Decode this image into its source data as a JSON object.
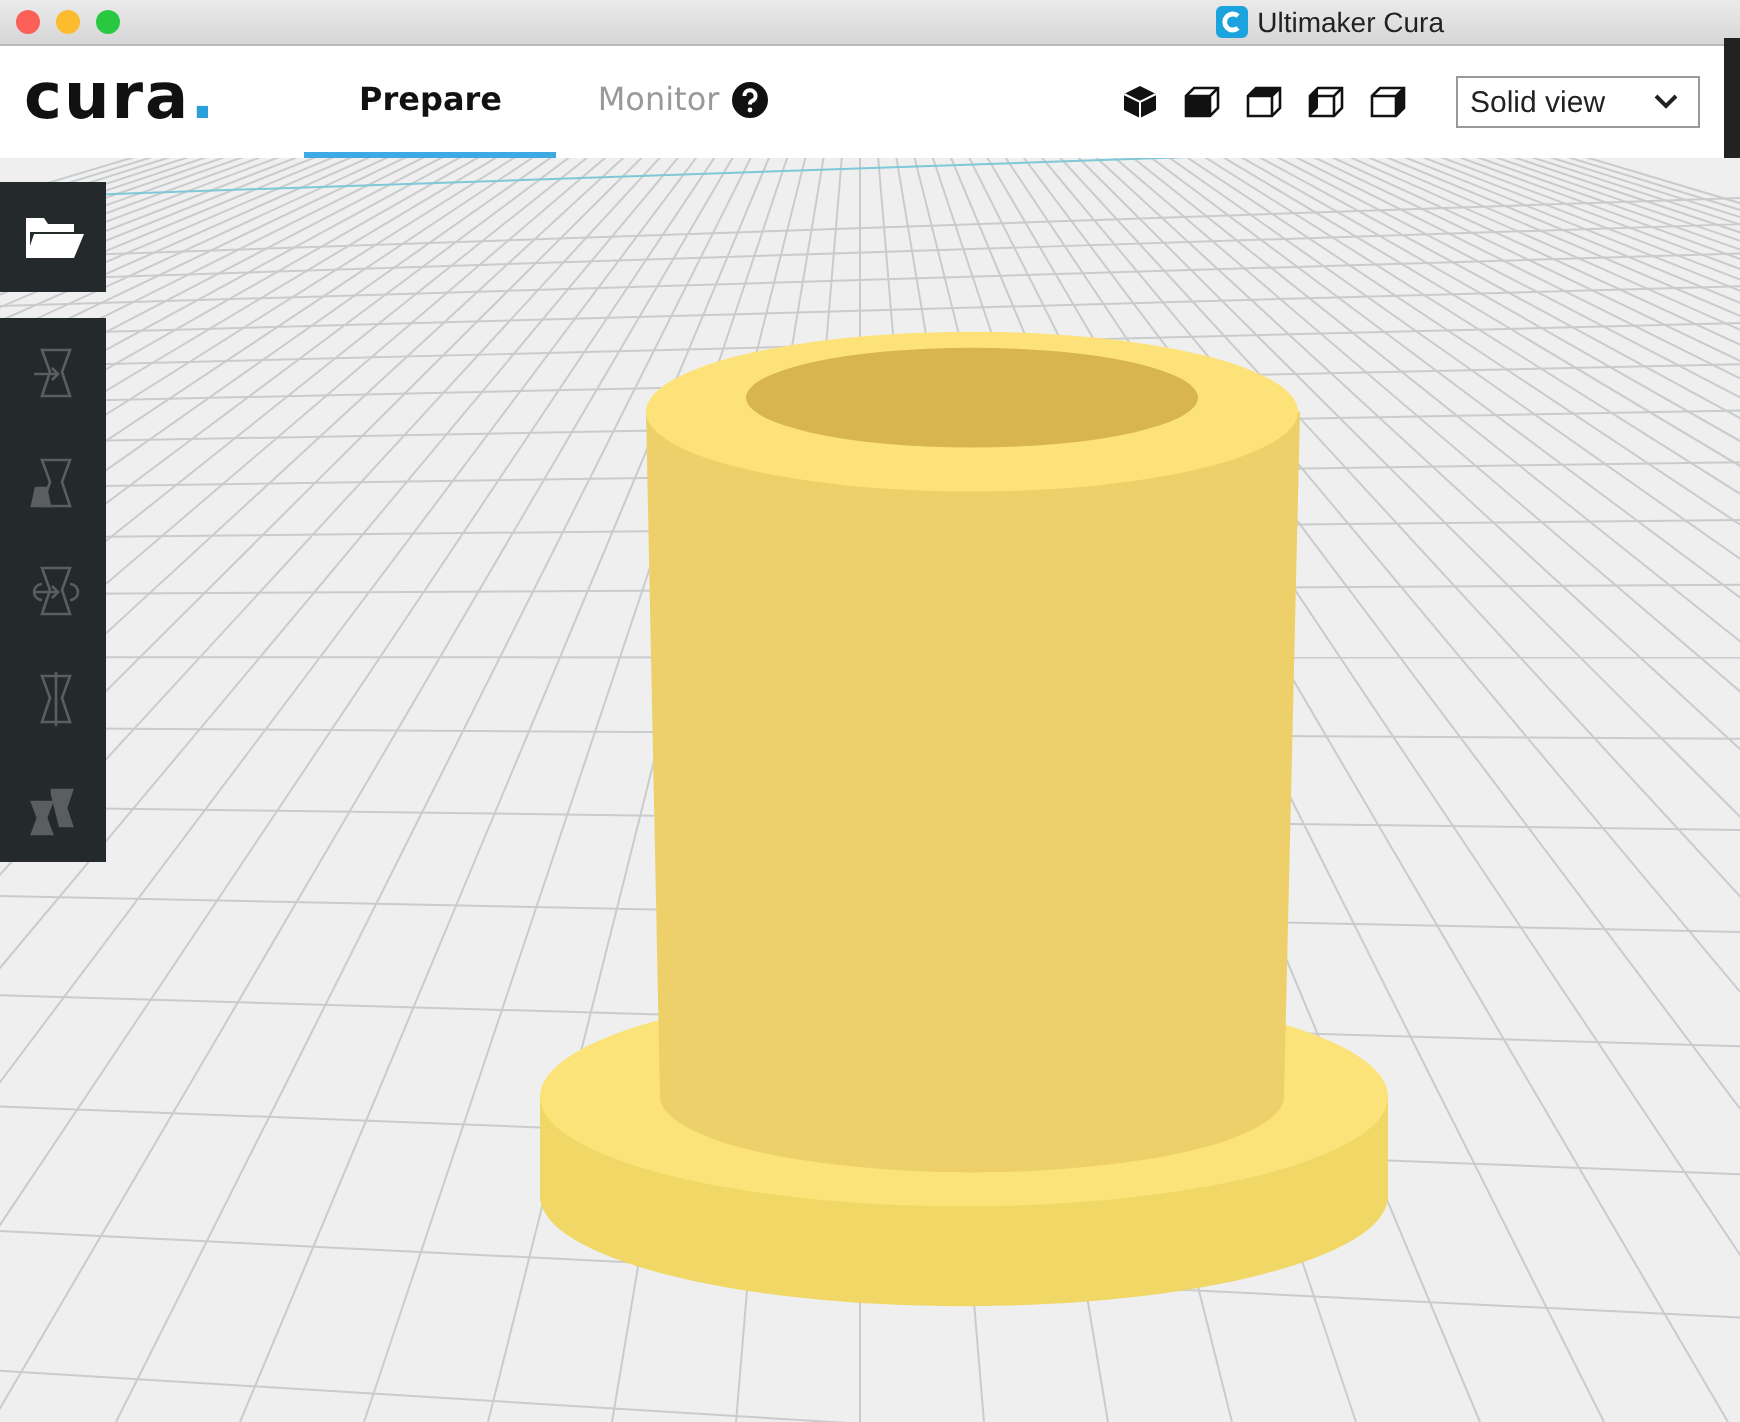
{
  "window": {
    "title": "Ultimaker Cura"
  },
  "header": {
    "logo": {
      "text": "cura",
      "dot": "."
    },
    "tabs": [
      {
        "label": "Prepare",
        "selected": true,
        "help": false
      },
      {
        "label": "Monitor",
        "selected": false,
        "help": true
      }
    ],
    "view_mode": {
      "value": "Solid view"
    }
  },
  "toolbar": {
    "tools": [
      {
        "kind": "move",
        "disabled": true
      },
      {
        "kind": "scale",
        "disabled": true
      },
      {
        "kind": "rotate",
        "disabled": true
      },
      {
        "kind": "mirror",
        "disabled": true
      },
      {
        "kind": "per-model",
        "disabled": true
      }
    ]
  }
}
